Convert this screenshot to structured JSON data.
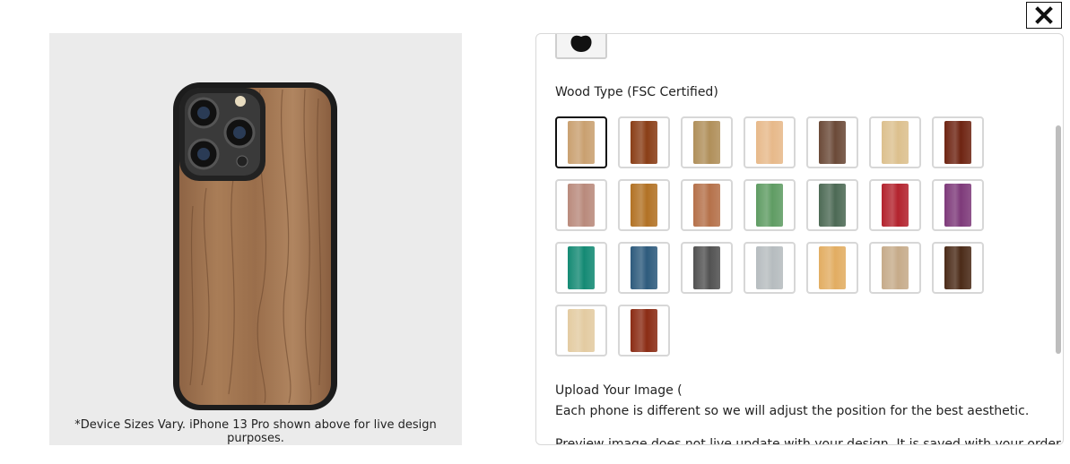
{
  "close_icon": "close-x-icon",
  "preview": {
    "caption": "*Device Sizes Vary.  iPhone 13 Pro shown above for live design purposes."
  },
  "options": {
    "brand_icon": "apple-logo-icon",
    "wood_label": "Wood Type (FSC Certified)",
    "wood_swatches": [
      {
        "color": "#c9a070",
        "selected": true
      },
      {
        "color": "#8a3e17"
      },
      {
        "color": "#b08f5a"
      },
      {
        "color": "#e7b98a"
      },
      {
        "color": "#6b4a38"
      },
      {
        "color": "#dcc08e"
      },
      {
        "color": "#6e2412"
      },
      {
        "color": "#b98a7c"
      },
      {
        "color": "#b27225"
      },
      {
        "color": "#b5714a"
      },
      {
        "color": "#5f9c63"
      },
      {
        "color": "#4d6a55"
      },
      {
        "color": "#b3232e"
      },
      {
        "color": "#7e3a7a"
      },
      {
        "color": "#148a74"
      },
      {
        "color": "#2e5b7d"
      },
      {
        "color": "#525252"
      },
      {
        "color": "#b6bcbf"
      },
      {
        "color": "#e2ad62"
      },
      {
        "color": "#c6ab8a"
      },
      {
        "color": "#4b2b18"
      },
      {
        "color": "#e3cba1"
      },
      {
        "color": "#8b2c15"
      }
    ],
    "upload_title": "Upload Your Image (",
    "upload_note": "Each phone is different so we will adjust the position for the best aesthetic.",
    "upload_note2": "Preview image does not live update with your design. It is saved with your order so"
  }
}
